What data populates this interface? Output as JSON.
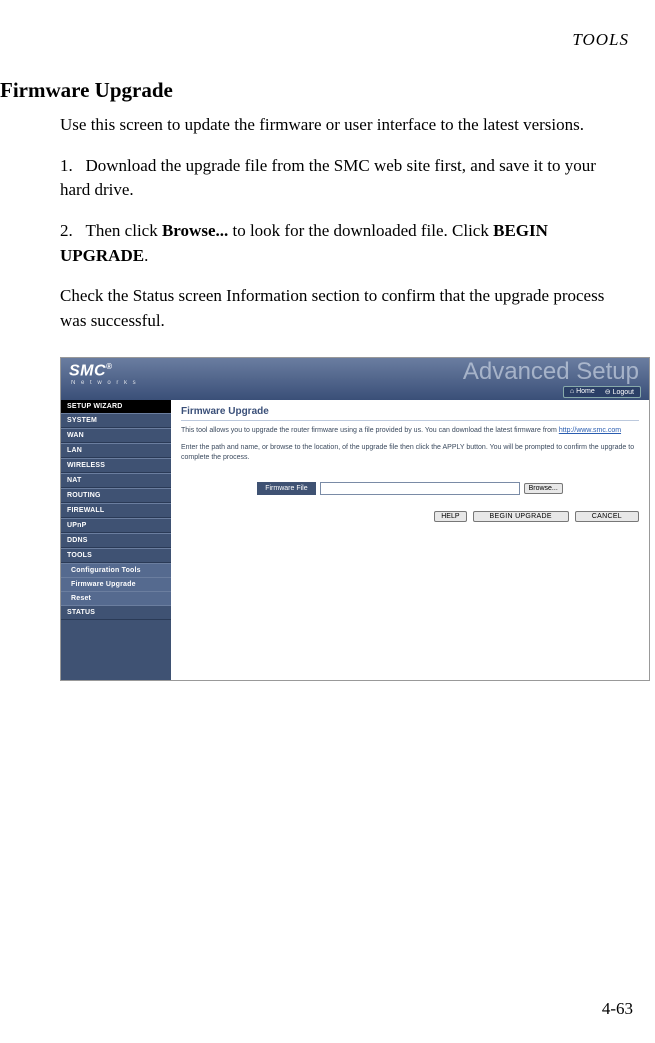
{
  "header": {
    "label": "TOOLS"
  },
  "section": {
    "heading": "Firmware Upgrade"
  },
  "intro": "Use this screen to update the firmware or user interface to the latest versions.",
  "steps": {
    "s1_num": "1.",
    "s1_text": "Download the upgrade file from the SMC web site first, and save it to your hard drive.",
    "s2_num": "2.",
    "s2a": "Then click ",
    "s2b": "Browse...",
    "s2c": " to look for the downloaded file. Click ",
    "s2d": "BEGIN UPGRADE",
    "s2e": "."
  },
  "post": "Check the Status screen Information section to confirm that the upgrade process was successful.",
  "shot": {
    "brand": "SMC",
    "brand_sup": "®",
    "brand_sub": "N e t w o r k s",
    "adv": "Advanced Setup",
    "home": "Home",
    "logout": "Logout",
    "sidebar": {
      "top": "SETUP WIZARD",
      "items": {
        "system": "SYSTEM",
        "wan": "WAN",
        "lan": "LAN",
        "wireless": "WIRELESS",
        "nat": "NAT",
        "routing": "ROUTING",
        "firewall": "FIREWALL",
        "upnp": "UPnP",
        "ddns": "DDNS",
        "tools": "TOOLS",
        "status": "STATUS"
      },
      "subitems": {
        "conf": "Configuration Tools",
        "fw": "Firmware Upgrade",
        "reset": "Reset"
      }
    },
    "content": {
      "title": "Firmware Upgrade",
      "p1a": "This tool allows you to upgrade the router firmware using a file provided by us. You can download the latest firmware from ",
      "p1_link": "http://www.smc.com",
      "p2": "Enter the path and name, or browse to the location, of the upgrade file then click the APPLY button. You will be prompted to confirm the upgrade to complete the process.",
      "field_label": "Firmware File",
      "browse": "Browse...",
      "help": "HELP",
      "begin": "BEGIN UPGRADE",
      "cancel": "CANCEL"
    }
  },
  "page_number": "4-63"
}
